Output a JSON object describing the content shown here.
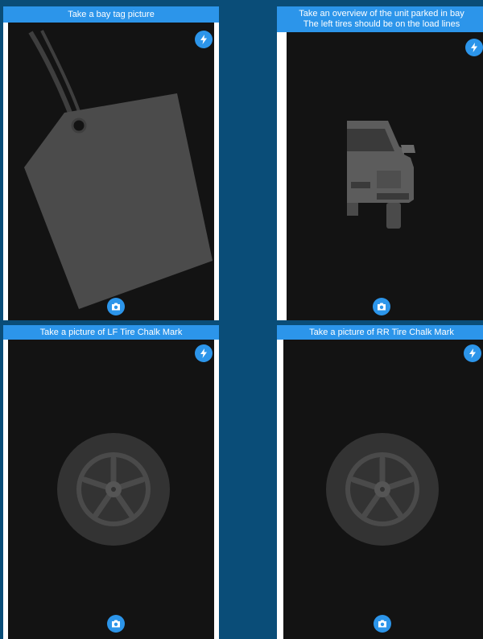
{
  "screens": [
    {
      "id": "bay-tag",
      "header_lines": [
        "Take a bay tag picture"
      ],
      "flash_icon": "flash-icon",
      "shutter_icon": "camera-icon",
      "overlay": "tag-silhouette"
    },
    {
      "id": "unit-overview",
      "header_lines": [
        "Take an overview of the unit parked in bay",
        "The left tires should be on the load lines"
      ],
      "flash_icon": "flash-icon",
      "shutter_icon": "camera-icon",
      "overlay": "car-front-silhouette"
    },
    {
      "id": "lf-tire",
      "header_lines": [
        "Take a picture of LF Tire Chalk Mark"
      ],
      "flash_icon": "flash-icon",
      "shutter_icon": "camera-icon",
      "overlay": "wheel-silhouette"
    },
    {
      "id": "rr-tire",
      "header_lines": [
        "Take a picture of RR Tire Chalk Mark"
      ],
      "flash_icon": "flash-icon",
      "shutter_icon": "camera-icon",
      "overlay": "wheel-silhouette"
    }
  ],
  "colors": {
    "background": "#0a4d78",
    "accent": "#2c95ea",
    "viewport": "#131313",
    "overlay_fill": "#4a4a4a"
  }
}
